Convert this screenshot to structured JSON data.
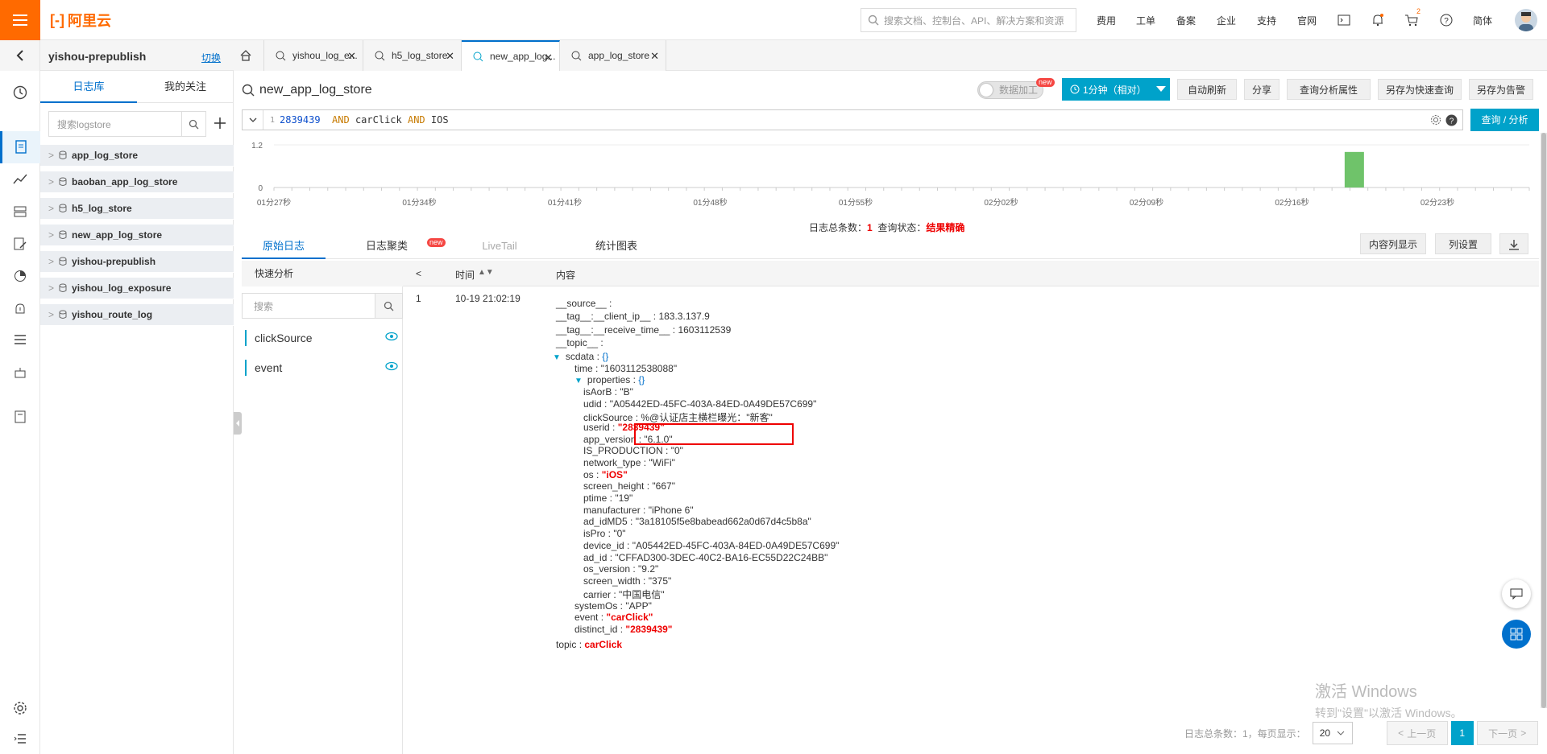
{
  "topbar": {
    "logo": "阿里云",
    "search_placeholder": "搜索文档、控制台、API、解决方案和资源",
    "nav": [
      "费用",
      "工单",
      "备案",
      "企业",
      "支持",
      "官网"
    ],
    "lang": "简体",
    "cart_count": "2"
  },
  "project": {
    "name": "yishou-prepublish",
    "switch": "切换",
    "tabs": [
      "日志库",
      "我的关注"
    ],
    "search_placeholder": "搜索logstore",
    "logstores": [
      "app_log_store",
      "baoban_app_log_store",
      "h5_log_store",
      "new_app_log_store",
      "yishou-prepublish",
      "yishou_log_exposure",
      "yishou_route_log"
    ]
  },
  "tabs": [
    {
      "label": "yishou_log_e..."
    },
    {
      "label": "h5_log_store"
    },
    {
      "label": "new_app_log..."
    },
    {
      "label": "app_log_store"
    }
  ],
  "header": {
    "title": "new_app_log_store",
    "toggle": "数据加工",
    "new_badge": "new",
    "time": "1分钟（相对）",
    "buttons": [
      "自动刷新",
      "分享",
      "查询分析属性",
      "另存为快速查询",
      "另存为告警"
    ]
  },
  "query": {
    "line_no": "1",
    "num": "2839439",
    "op1": "AND",
    "term1": "carClick",
    "op2": "AND",
    "term2": "IOS",
    "button": "查询 / 分析"
  },
  "chart_data": {
    "type": "bar",
    "ylim": [
      0,
      1.2
    ],
    "yticks": [
      "1.2",
      "0"
    ],
    "xticks": [
      "01分27秒",
      "01分34秒",
      "01分41秒",
      "01分48秒",
      "01分55秒",
      "02分02秒",
      "02分09秒",
      "02分16秒",
      "02分23秒"
    ],
    "bars": [
      {
        "x": "02分19秒",
        "value": 1
      }
    ],
    "bar_color": "#6fc36a"
  },
  "stats": {
    "total_label": "日志总条数：",
    "total": "1",
    "status_label": "查询状态：",
    "status": "结果精确"
  },
  "result_tabs": [
    "原始日志",
    "日志聚类",
    "LiveTail",
    "统计图表"
  ],
  "result_buttons": [
    "内容列显示",
    "列设置"
  ],
  "quick": {
    "title": "快速分析",
    "search_placeholder": "搜索",
    "fields": [
      "clickSource",
      "event"
    ]
  },
  "table": {
    "headers": [
      "时间",
      "内容"
    ],
    "row_no": "1",
    "time": "10-19 21:02:19",
    "lines": [
      {
        "k": "__source__",
        "v": "",
        "indent": 0
      },
      {
        "k": "__tag__:__client_ip__",
        "v": "183.3.137.9",
        "indent": 0
      },
      {
        "k": "__tag__:__receive_time__",
        "v": "1603112539",
        "indent": 0
      },
      {
        "k": "__topic__",
        "v": "",
        "indent": 0
      },
      {
        "k": "scdata",
        "v": "{}",
        "indent": 0,
        "tri": true,
        "blue": true
      },
      {
        "k": "time",
        "v": "\"1603112538088\"",
        "indent": 1
      },
      {
        "k": "properties",
        "v": "{}",
        "indent": 1,
        "tri": true,
        "blue": true
      },
      {
        "k": "isAorB",
        "v": "\"B\"",
        "indent": 2
      },
      {
        "k": "udid",
        "v": "\"A05442ED-45FC-403A-84ED-0A49DE57C699\"",
        "indent": 2
      },
      {
        "k": "clickSource",
        "v": "%@认证店主横栏曝光：\"新客\"",
        "indent": 2
      },
      {
        "k": "userid",
        "v": "\"2839439\"",
        "indent": 2,
        "red": true
      },
      {
        "k": "app_version",
        "v": "\"6.1.0\"",
        "indent": 2
      },
      {
        "k": "IS_PRODUCTION",
        "v": "\"0\"",
        "indent": 2
      },
      {
        "k": "network_type",
        "v": "\"WiFi\"",
        "indent": 2
      },
      {
        "k": "os",
        "v": "\"iOS\"",
        "indent": 2,
        "red": true
      },
      {
        "k": "screen_height",
        "v": "\"667\"",
        "indent": 2
      },
      {
        "k": "ptime",
        "v": "\"19\"",
        "indent": 2
      },
      {
        "k": "manufacturer",
        "v": "\"iPhone 6\"",
        "indent": 2
      },
      {
        "k": "ad_idMD5",
        "v": "\"3a18105f5e8babead662a0d67d4c5b8a\"",
        "indent": 2
      },
      {
        "k": "isPro",
        "v": "\"0\"",
        "indent": 2
      },
      {
        "k": "device_id",
        "v": "\"A05442ED-45FC-403A-84ED-0A49DE57C699\"",
        "indent": 2
      },
      {
        "k": "ad_id",
        "v": "\"CFFAD300-3DEC-40C2-BA16-EC55D22C24BB\"",
        "indent": 2
      },
      {
        "k": "os_version",
        "v": "\"9.2\"",
        "indent": 2
      },
      {
        "k": "screen_width",
        "v": "\"375\"",
        "indent": 2
      },
      {
        "k": "carrier",
        "v": "\"中国电信\"",
        "indent": 2
      },
      {
        "k": "systemOs",
        "v": "\"APP\"",
        "indent": 1
      },
      {
        "k": "event",
        "v": "\"carClick\"",
        "indent": 1,
        "red": true
      },
      {
        "k": "distinct_id",
        "v": "\"2839439\"",
        "indent": 1,
        "red": true
      },
      {
        "k": "topic",
        "v": "carClick",
        "indent": 0,
        "red": true
      }
    ]
  },
  "pager": {
    "total_label": "日志总条数：1，每页显示：",
    "page_size": "20",
    "prev": "上一页",
    "current": "1",
    "next": "下一页"
  },
  "watermark": {
    "line1": "激活 Windows",
    "line2": "转到\"设置\"以激活 Windows。"
  }
}
